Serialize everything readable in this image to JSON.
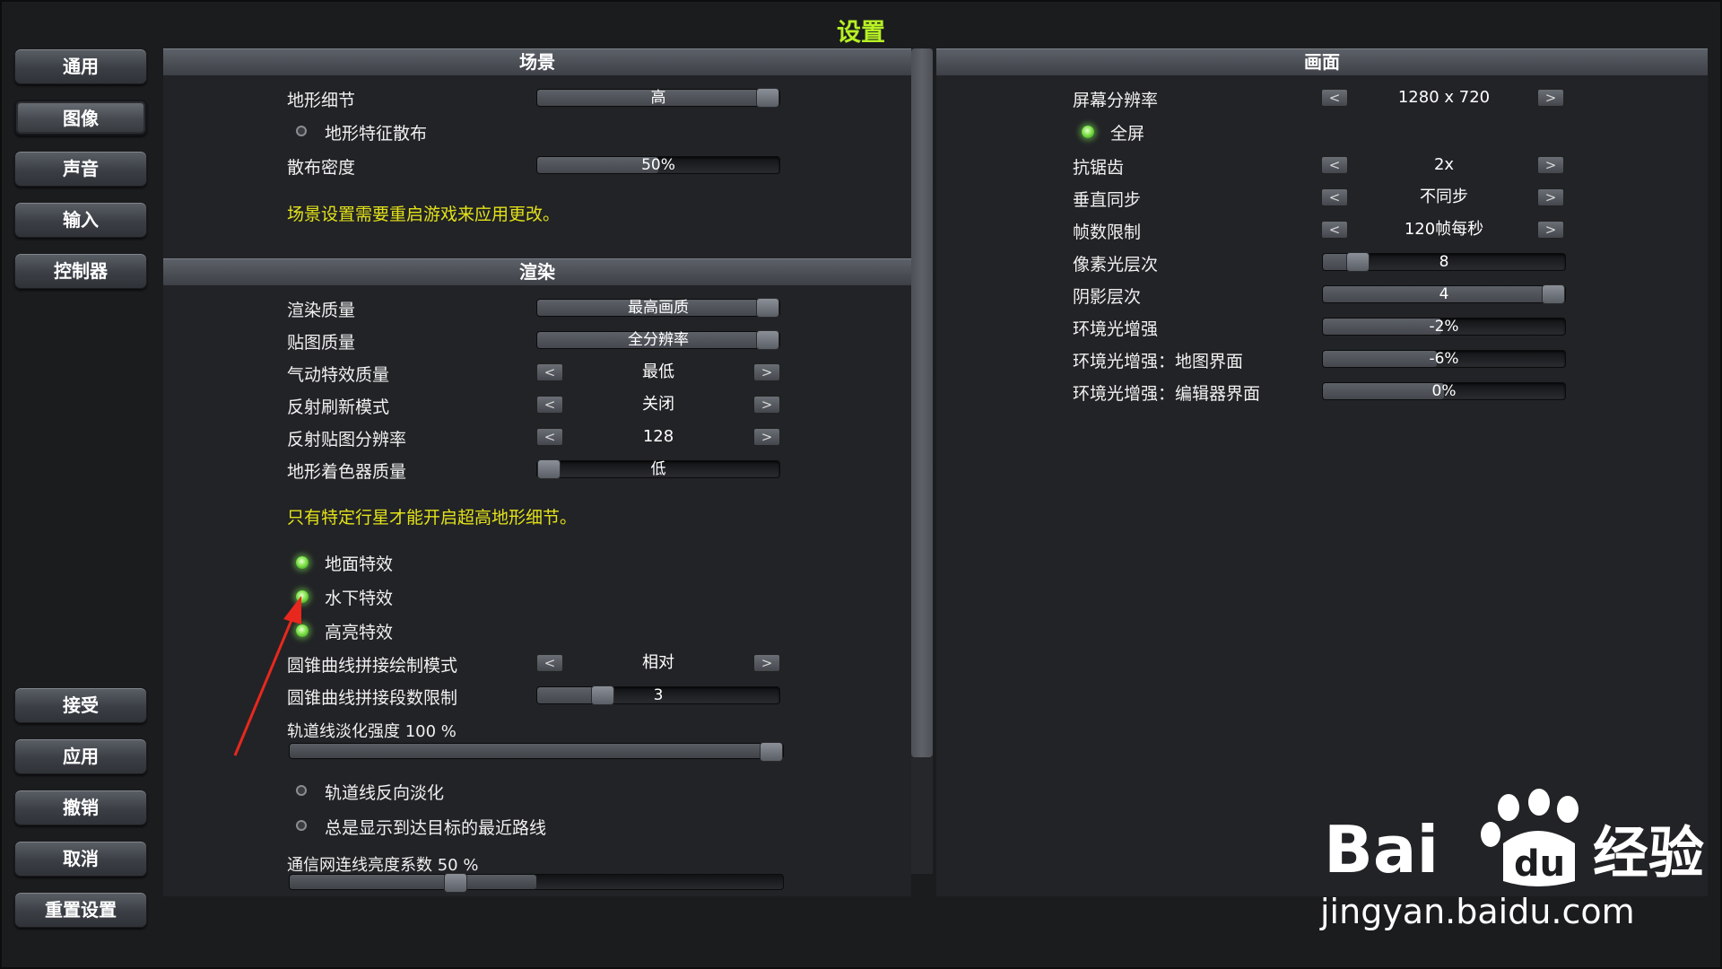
{
  "window": {
    "title": "设置"
  },
  "nav": {
    "top": [
      "通用",
      "图像",
      "声音",
      "输入",
      "控制器"
    ],
    "bottom": [
      "接受",
      "应用",
      "撤销",
      "取消",
      "重置设置"
    ],
    "active": "图像"
  },
  "scene": {
    "header": "场景",
    "terrain_detail": {
      "label": "地形细节",
      "value": "高"
    },
    "terrain_scatter": {
      "label": "地形特征散布",
      "enabled": false
    },
    "scatter_density": {
      "label": "散布密度",
      "value": "50%"
    },
    "note": "场景设置需要重启游戏来应用更改。"
  },
  "render": {
    "header": "渲染",
    "render_quality": {
      "label": "渲染质量",
      "value": "最高画质"
    },
    "texture_quality": {
      "label": "贴图质量",
      "value": "全分辨率"
    },
    "aero_fx_quality": {
      "label": "气动特效质量",
      "value": "最低"
    },
    "reflection_refresh": {
      "label": "反射刷新模式",
      "value": "关闭"
    },
    "reflection_res": {
      "label": "反射贴图分辨率",
      "value": "128"
    },
    "terrain_shader": {
      "label": "地形着色器质量",
      "value": "低"
    },
    "note": "只有特定行星才能开启超高地形细节。",
    "ground_fx": {
      "label": "地面特效",
      "enabled": true
    },
    "underwater_fx": {
      "label": "水下特效",
      "enabled": true
    },
    "highlight_fx": {
      "label": "高亮特效",
      "enabled": true
    },
    "conic_mode": {
      "label": "圆锥曲线拼接绘制模式",
      "value": "相对"
    },
    "conic_limit": {
      "label": "圆锥曲线拼接段数限制",
      "value": "3",
      "level": 0.27
    },
    "orbit_fade": {
      "label": "轨道线淡化强度 100 %",
      "level": 1.0
    },
    "orbit_reverse_fade": {
      "label": "轨道线反向淡化",
      "enabled": false
    },
    "nearest_path": {
      "label": "总是显示到达目标的最近路线",
      "enabled": false
    },
    "commnet_brightness": {
      "label": "通信网连线亮度系数 50 %",
      "level": 0.5
    }
  },
  "display": {
    "header": "画面",
    "resolution": {
      "label": "屏幕分辨率",
      "value": "1280 x 720"
    },
    "fullscreen": {
      "label": "全屏",
      "enabled": true
    },
    "antialias": {
      "label": "抗锯齿",
      "value": "2x"
    },
    "vsync": {
      "label": "垂直同步",
      "value": "不同步"
    },
    "frame_limit": {
      "label": "帧数限制",
      "value": "120帧每秒"
    },
    "pixel_light": {
      "label": "像素光层次",
      "value": "8",
      "level": 0.14
    },
    "shadow_cascades": {
      "label": "阴影层次",
      "value": "4",
      "level": 1.0
    },
    "ambient_boost": {
      "label": "环境光增强",
      "value": "-2%"
    },
    "ambient_map": {
      "label": "环境光增强：地图界面",
      "value": "-6%"
    },
    "ambient_editor": {
      "label": "环境光增强：编辑器界面",
      "value": "0%"
    },
    "arrow_left": "<",
    "arrow_right": ">"
  },
  "watermark": {
    "brand": "Bai",
    "suffix": "经验",
    "url": "jingyan.baidu.com"
  },
  "colors": {
    "accent": "#b6f024",
    "note": "#e2e21a",
    "led": "#7ee34a",
    "annotation": "#e8281e"
  }
}
